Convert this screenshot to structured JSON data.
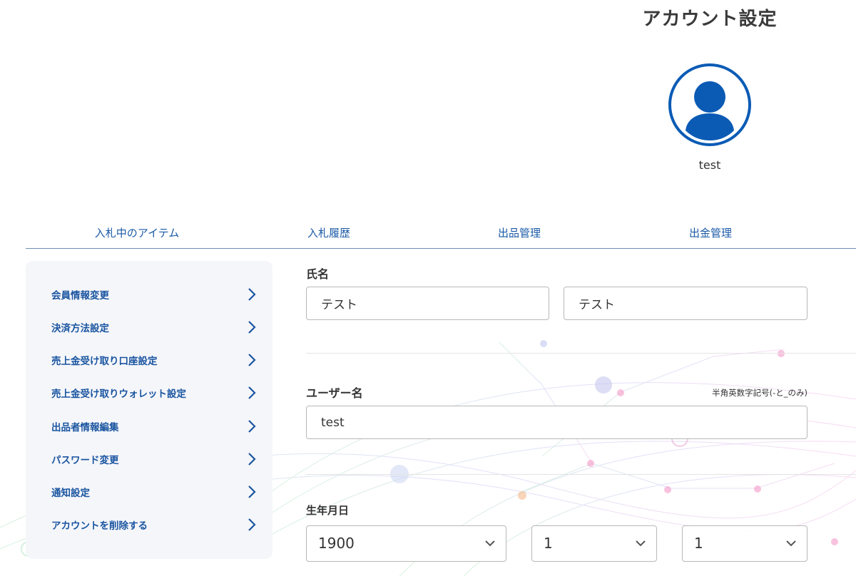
{
  "header": {
    "title": "アカウント設定",
    "username": "test"
  },
  "tabs": [
    {
      "label": "入札中のアイテム"
    },
    {
      "label": "入札履歴"
    },
    {
      "label": "出品管理"
    },
    {
      "label": "出金管理"
    }
  ],
  "sidebar": {
    "items": [
      {
        "label": "会員情報変更"
      },
      {
        "label": "決済方法設定"
      },
      {
        "label": "売上金受け取り口座設定"
      },
      {
        "label": "売上金受け取りウォレット設定"
      },
      {
        "label": "出品者情報編集"
      },
      {
        "label": "パスワード変更"
      },
      {
        "label": "通知設定"
      },
      {
        "label": "アカウントを削除する"
      }
    ]
  },
  "form": {
    "name_label": "氏名",
    "last_name_value": "テスト",
    "first_name_value": "テスト",
    "username_label": "ユーザー名",
    "username_hint": "半角英数字記号(-と_のみ)",
    "username_value": "test",
    "birthday_label": "生年月日",
    "birth_year": "1900",
    "birth_month": "1",
    "birth_day": "1"
  },
  "colors": {
    "accent": "#0b5bb5",
    "link": "#1a55a0"
  }
}
